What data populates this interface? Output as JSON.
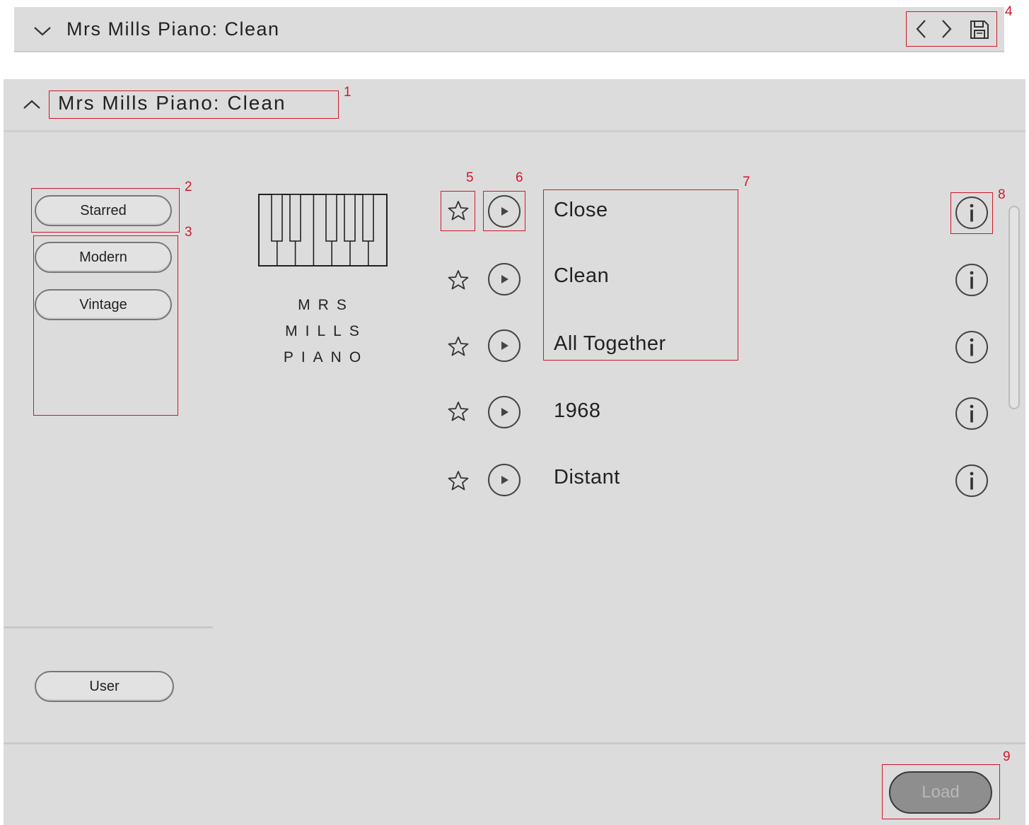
{
  "collapsed_header": {
    "title": "Mrs Mills Piano: Clean"
  },
  "panel": {
    "title": "Mrs Mills Piano: Clean"
  },
  "categories": [
    {
      "label": "Starred"
    },
    {
      "label": "Modern"
    },
    {
      "label": "Vintage"
    }
  ],
  "user_button": "User",
  "logo": {
    "line1": "MRS",
    "line2": "MILLS",
    "line3": "PIANO"
  },
  "presets": [
    {
      "name": "Close"
    },
    {
      "name": "Clean"
    },
    {
      "name": "All Together"
    },
    {
      "name": "1968"
    },
    {
      "name": "Distant"
    }
  ],
  "load_button": "Load",
  "callouts": [
    "1",
    "2",
    "3",
    "4",
    "5",
    "6",
    "7",
    "8",
    "9"
  ],
  "icons": {
    "collapse": "chevron-down-icon",
    "expand": "chevron-up-icon",
    "prev": "chevron-left-icon",
    "next": "chevron-right-icon",
    "save": "save-icon",
    "star": "star-icon",
    "play": "play-icon",
    "info": "info-icon"
  },
  "colors": {
    "panel_bg": "#dcdcdc",
    "annotation_red": "#d0182a",
    "load_button_bg": "#8e8e8e"
  }
}
